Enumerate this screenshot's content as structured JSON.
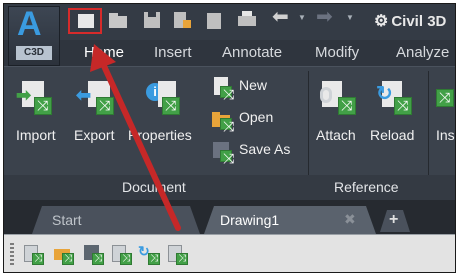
{
  "app": {
    "logo_letter": "A",
    "logo_badge": "C3D"
  },
  "quick_access": {
    "workspace_label": "Civil 3D",
    "icons": [
      "new-icon",
      "open-icon",
      "save-icon",
      "save-as-icon",
      "open-from-web-icon",
      "print-icon",
      "undo-icon",
      "redo-icon"
    ]
  },
  "ribbon_tabs": [
    "Home",
    "Insert",
    "Annotate",
    "Modify",
    "Analyze"
  ],
  "active_tab": "Home",
  "ribbon": {
    "document_group": {
      "label": "Document",
      "buttons": {
        "import": "Import",
        "export": "Export",
        "properties": "Properties"
      },
      "small_buttons": {
        "new": "New",
        "open": "Open",
        "save_as": "Save As"
      }
    },
    "reference_group": {
      "label": "Reference",
      "buttons": {
        "attach": "Attach",
        "reload": "Reload"
      }
    },
    "next_group_partial": "Ins"
  },
  "document_tabs": {
    "start": "Start",
    "drawing": "Drawing1",
    "new_tab": "+"
  },
  "toolbar_icons": [
    "import-icon",
    "open-icon",
    "save-icon",
    "export-icon",
    "reload-icon",
    "attach-icon"
  ],
  "colors": {
    "annotation_arrow": "#c62828",
    "highlight_box": "#d62b2b",
    "accent_green": "#42a047"
  }
}
